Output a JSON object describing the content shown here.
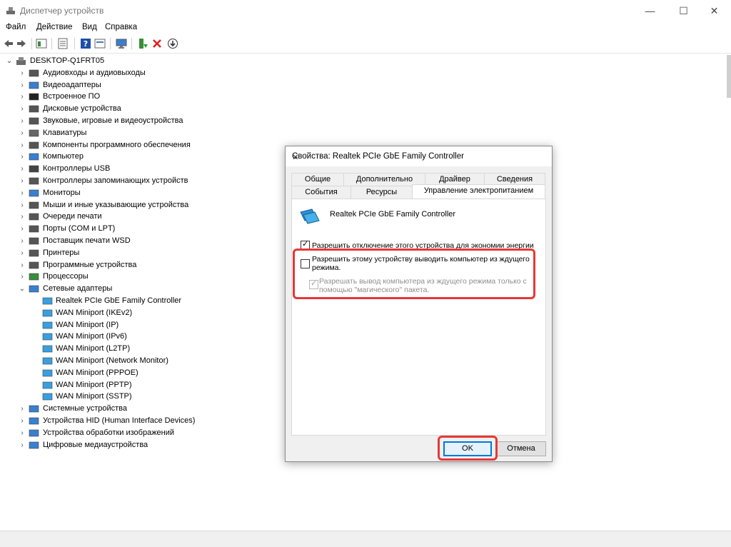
{
  "window": {
    "title": "Диспетчер устройств",
    "min_icon": "—",
    "max_icon": "☐",
    "close_icon": "✕"
  },
  "menu": [
    "Файл",
    "Действие",
    "Вид",
    "Справка"
  ],
  "tree": {
    "root": "DESKTOP-Q1FRT05",
    "categories": [
      "Аудиовходы и аудиовыходы",
      "Видеоадаптеры",
      "Встроенное ПО",
      "Дисковые устройства",
      "Звуковые, игровые и видеоустройства",
      "Клавиатуры",
      "Компоненты программного обеспечения",
      "Компьютер",
      "Контроллеры USB",
      "Контроллеры запоминающих устройств",
      "Мониторы",
      "Мыши и иные указывающие устройства",
      "Очереди печати",
      "Порты (COM и LPT)",
      "Поставщик печати WSD",
      "Принтеры",
      "Программные устройства",
      "Процессоры",
      "Сетевые адаптеры"
    ],
    "network_children": [
      "Realtek PCIe GbE Family Controller",
      "WAN Miniport (IKEv2)",
      "WAN Miniport (IP)",
      "WAN Miniport (IPv6)",
      "WAN Miniport (L2TP)",
      "WAN Miniport (Network Monitor)",
      "WAN Miniport (PPPOE)",
      "WAN Miniport (PPTP)",
      "WAN Miniport (SSTP)"
    ],
    "categories_after": [
      "Системные устройства",
      "Устройства HID (Human Interface Devices)",
      "Устройства обработки изображений",
      "Цифровые медиаустройства"
    ]
  },
  "dialog": {
    "title": "Свойства: Realtek PCIe GbE Family Controller",
    "close_icon": "✕",
    "tabs_row1": [
      "Общие",
      "Дополнительно",
      "Драйвер",
      "Сведения"
    ],
    "tabs_row2": [
      "События",
      "Ресурсы",
      "Управление электропитанием"
    ],
    "active_tab": "Управление электропитанием",
    "device_name": "Realtek PCIe GbE Family Controller",
    "options": [
      {
        "label": "Разрешить отключение этого устройства для экономии энергии",
        "checked": true,
        "enabled": true
      },
      {
        "label_line1": "Разрешить этому устройству выводить компьютер из ждущего",
        "label_line2": "режима.",
        "checked": false,
        "enabled": true
      },
      {
        "label_line1": "Разрешать вывод компьютера из ждущего режима только с",
        "label_line2": "помощью \"магического\" пакета.",
        "checked": true,
        "enabled": false
      }
    ],
    "ok_label": "OK",
    "cancel_label": "Отмена"
  },
  "colors": {
    "highlight": "#e53935",
    "selection": "#cce8ff",
    "accent": "#0078d7"
  }
}
